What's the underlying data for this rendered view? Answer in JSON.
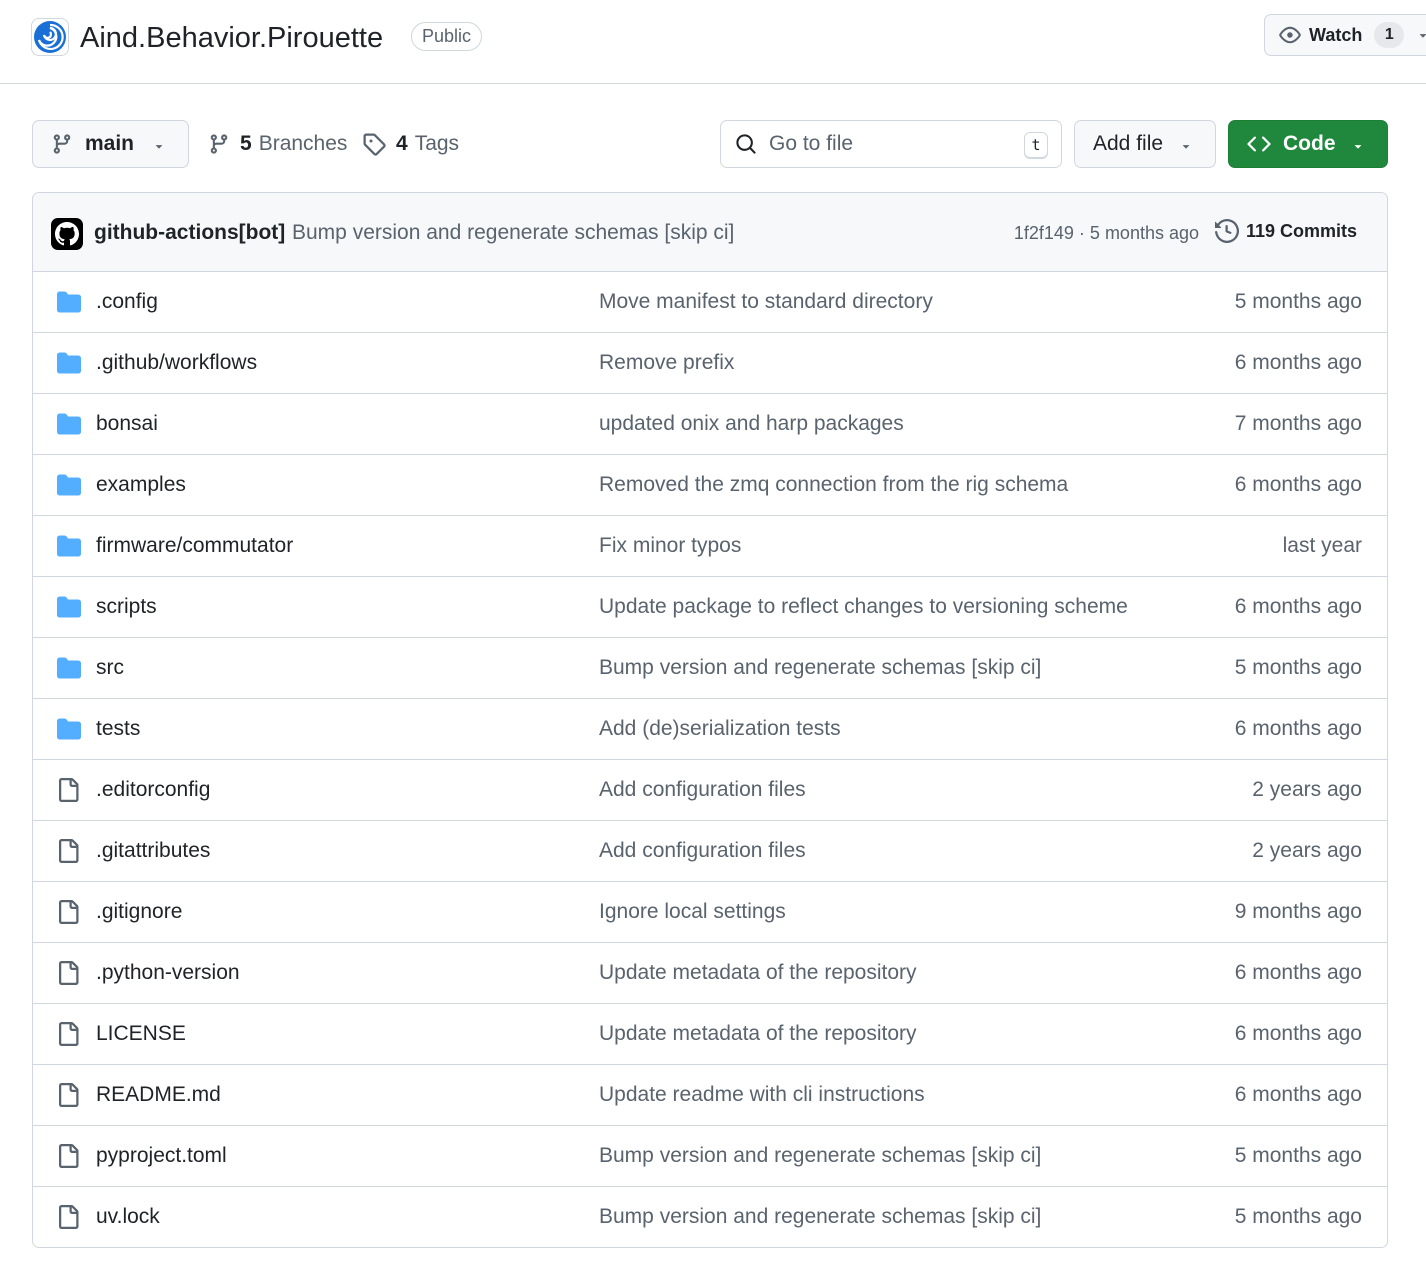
{
  "repo": {
    "name": "Aind.Behavior.Pirouette",
    "visibility": "Public",
    "watch_label": "Watch",
    "watch_count": "1"
  },
  "toolbar": {
    "branch": "main",
    "branches_count": "5",
    "branches_label": "Branches",
    "tags_count": "4",
    "tags_label": "Tags",
    "search_placeholder": "Go to file",
    "search_shortcut": "t",
    "add_file_label": "Add file",
    "code_label": "Code"
  },
  "latest_commit": {
    "author": "github-actions[bot]",
    "message": "Bump version and regenerate schemas [skip ci]",
    "meta": "1f2f149 · 5 months ago",
    "commits_label": "119 Commits"
  },
  "files": [
    {
      "type": "folder",
      "name": ".config",
      "message": "Move manifest to standard directory",
      "age": "5 months ago"
    },
    {
      "type": "folder",
      "name": ".github/workflows",
      "message": "Remove prefix",
      "age": "6 months ago"
    },
    {
      "type": "folder",
      "name": "bonsai",
      "message": "updated onix and harp packages",
      "age": "7 months ago"
    },
    {
      "type": "folder",
      "name": "examples",
      "message": "Removed the zmq connection from the rig schema",
      "age": "6 months ago"
    },
    {
      "type": "folder",
      "name": "firmware/commutator",
      "message": "Fix minor typos",
      "age": "last year"
    },
    {
      "type": "folder",
      "name": "scripts",
      "message": "Update package to reflect changes to versioning scheme",
      "age": "6 months ago"
    },
    {
      "type": "folder",
      "name": "src",
      "message": "Bump version and regenerate schemas [skip ci]",
      "age": "5 months ago"
    },
    {
      "type": "folder",
      "name": "tests",
      "message": "Add (de)serialization tests",
      "age": "6 months ago"
    },
    {
      "type": "file",
      "name": ".editorconfig",
      "message": "Add configuration files",
      "age": "2 years ago"
    },
    {
      "type": "file",
      "name": ".gitattributes",
      "message": "Add configuration files",
      "age": "2 years ago"
    },
    {
      "type": "file",
      "name": ".gitignore",
      "message": "Ignore local settings",
      "age": "9 months ago"
    },
    {
      "type": "file",
      "name": ".python-version",
      "message": "Update metadata of the repository",
      "age": "6 months ago"
    },
    {
      "type": "file",
      "name": "LICENSE",
      "message": "Update metadata of the repository",
      "age": "6 months ago"
    },
    {
      "type": "file",
      "name": "README.md",
      "message": "Update readme with cli instructions",
      "age": "6 months ago"
    },
    {
      "type": "file",
      "name": "pyproject.toml",
      "message": "Bump version and regenerate schemas [skip ci]",
      "age": "5 months ago"
    },
    {
      "type": "file",
      "name": "uv.lock",
      "message": "Bump version and regenerate schemas [skip ci]",
      "age": "5 months ago"
    }
  ],
  "colors": {
    "folder": "#54aeff",
    "file_icon": "#59636e",
    "code_button": "#1f883d",
    "muted_text": "#59636e",
    "border": "#d0d7de"
  }
}
